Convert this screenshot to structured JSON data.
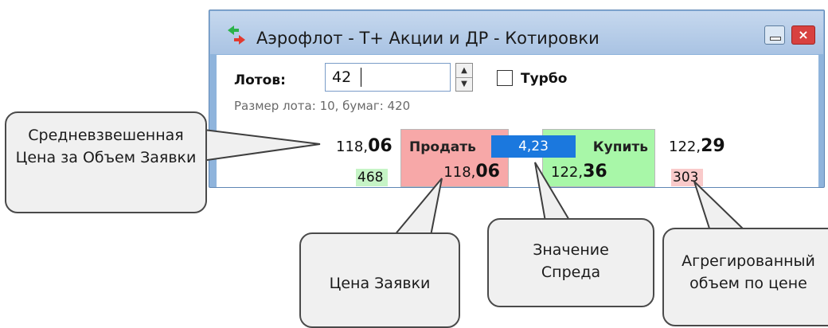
{
  "window": {
    "title": "Аэрофлот - Т+ Акции и ДР - Котировки",
    "close_glyph": "×"
  },
  "form": {
    "lots_label": "Лотов:",
    "lots_value": "42",
    "turbo_label": "Турбо",
    "turbo_checked": false,
    "lot_size_text": "Размер лота: 10, бумаг: 420"
  },
  "quotes": {
    "avg_sell_int": "118,",
    "avg_sell_frac": "06",
    "sell_volume": "468",
    "sell_label": "Продать",
    "sell_price_int": "118,",
    "sell_price_frac": "06",
    "spread": "4,23",
    "buy_label": "Купить",
    "buy_price_int": "122,",
    "buy_price_frac": "36",
    "avg_buy_int": "122,",
    "avg_buy_frac": "29",
    "buy_volume": "303"
  },
  "callouts": {
    "weighted_price": "Средневзвешенная Цена за Объем Заявки",
    "order_price": "Цена Заявки",
    "spread_value": "Значение Спреда",
    "aggregated_volume": "Агрегированный объем по цене"
  },
  "colors": {
    "sell_bg": "#f7a8a8",
    "buy_bg": "#a8f7a8",
    "spread_bg": "#1b78de",
    "title_bar": "#b8cfe9"
  },
  "icons": {
    "app": "arrows-swap-icon",
    "minimize": "minimize-icon",
    "close": "close-icon",
    "spin_up": "chevron-up-icon",
    "spin_down": "chevron-down-icon"
  }
}
